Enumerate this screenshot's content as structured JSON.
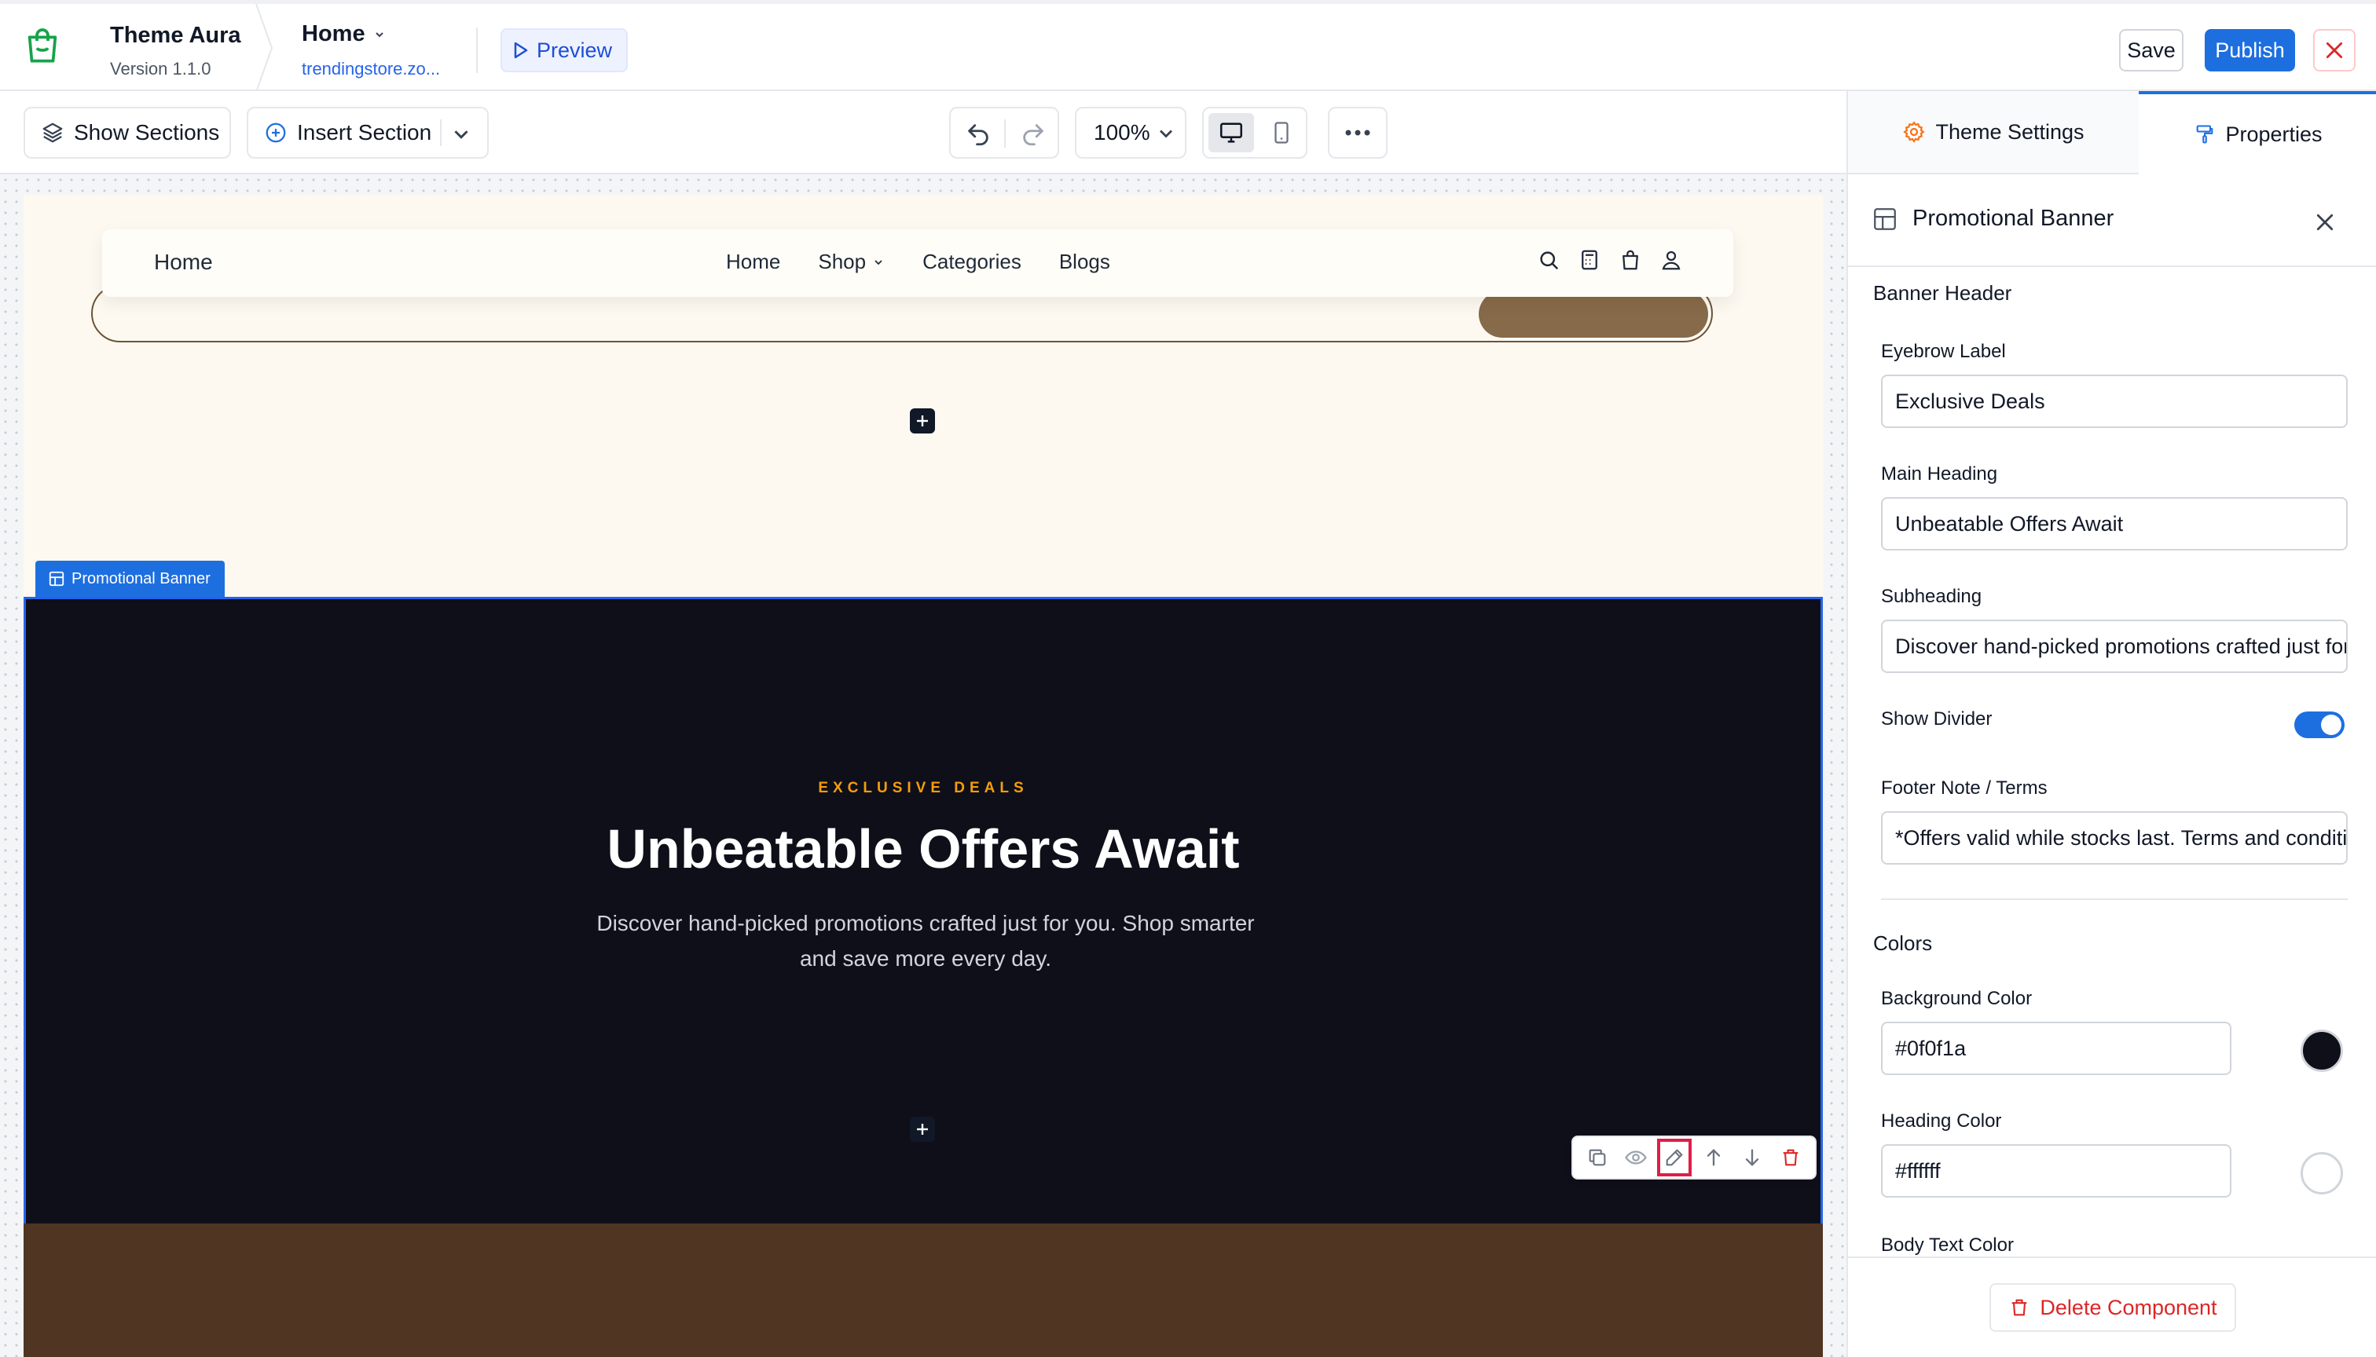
{
  "app": {
    "name": "Theme Aura",
    "version": "Version 1.1.0"
  },
  "page": {
    "name": "Home",
    "url": "trendingstore.zo..."
  },
  "header": {
    "preview_label": "Preview",
    "save_label": "Save",
    "publish_label": "Publish"
  },
  "toolbar": {
    "show_sections_label": "Show Sections",
    "insert_section_label": "Insert Section",
    "zoom": "100%"
  },
  "storefront": {
    "nav_home": "Home",
    "nav_links": [
      "Home",
      "Shop",
      "Categories",
      "Blogs"
    ]
  },
  "section_tag": "Promotional Banner",
  "banner": {
    "eyebrow": "EXCLUSIVE DEALS",
    "heading": "Unbeatable Offers Await",
    "subheading_line1": "Discover hand-picked promotions crafted just for you. Shop smarter",
    "subheading_line2": "and save more every day."
  },
  "panel": {
    "tabs": {
      "theme_settings": "Theme Settings",
      "properties": "Properties"
    },
    "component_title": "Promotional Banner",
    "groups": {
      "banner_header": "Banner Header",
      "colors": "Colors"
    },
    "labels": {
      "eyebrow": "Eyebrow Label",
      "heading": "Main Heading",
      "subheading": "Subheading",
      "show_divider": "Show Divider",
      "footer_note": "Footer Note / Terms",
      "background_color": "Background Color",
      "heading_color": "Heading Color",
      "body_text_color": "Body Text Color"
    },
    "values": {
      "eyebrow": "Exclusive Deals",
      "heading": "Unbeatable Offers Await",
      "subheading": "Discover hand-picked promotions crafted just for you",
      "footer_note": "*Offers valid while stocks last. Terms and conditions apply",
      "background_color": "#0f0f1a",
      "heading_color": "#ffffff"
    },
    "show_divider": true,
    "delete_label": "Delete Component"
  },
  "colors": {
    "accent": "#1d6fe0",
    "banner_bg": "#0f0f1a",
    "eyebrow": "#f59e0b",
    "page_bg": "#fdf9f1",
    "danger": "#dc2626"
  }
}
